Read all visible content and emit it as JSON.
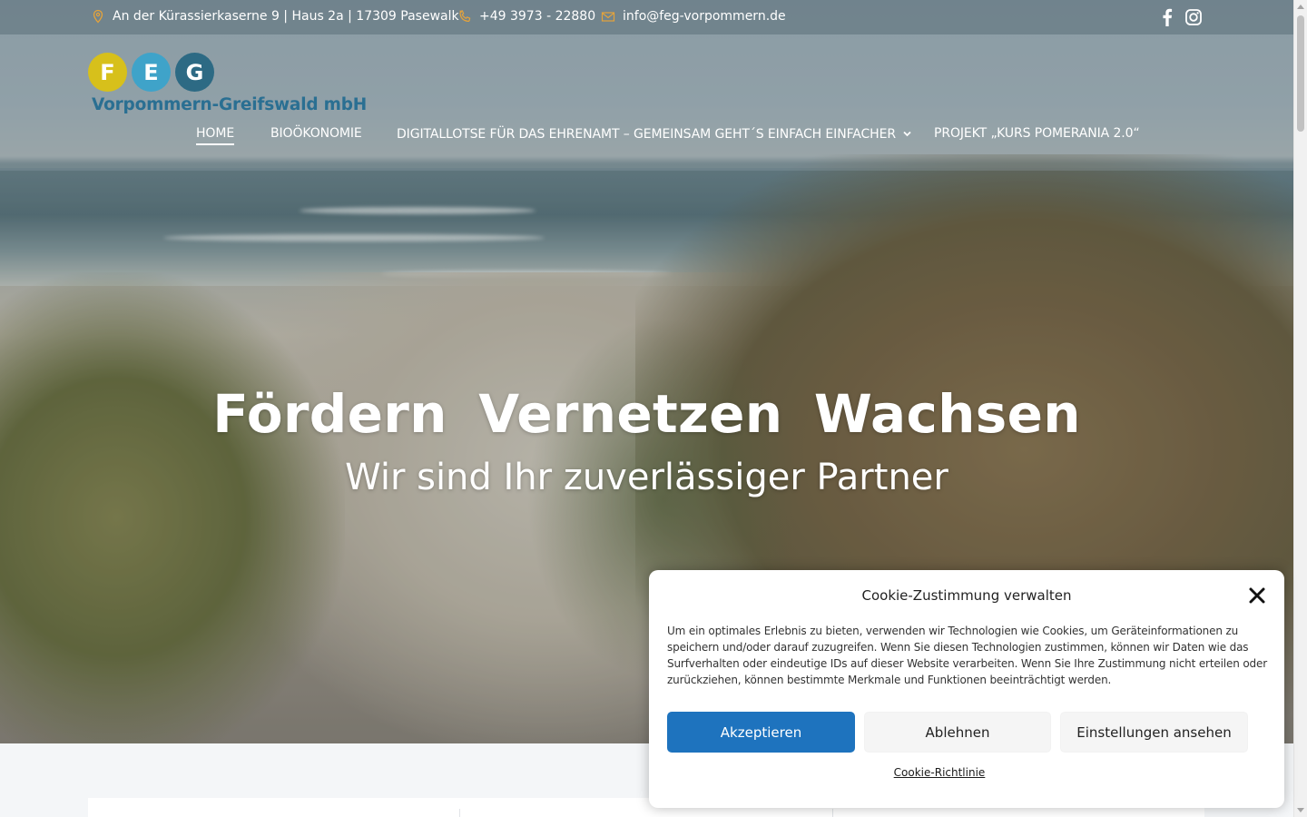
{
  "topbar": {
    "address": "An der Kürassierkaserne 9 | Haus 2a | 17309 Pasewalk",
    "phone": "+49 3973 - 22880",
    "email": "info@feg-vorpommern.de",
    "icons": [
      "location-pin-icon",
      "phone-icon",
      "mail-icon",
      "facebook-icon",
      "instagram-icon"
    ],
    "accent_color": "#e5a33b"
  },
  "logo": {
    "letters": [
      "F",
      "E",
      "G"
    ],
    "circle_colors": [
      "#d7c01b",
      "#3fa3c9",
      "#2d6a84"
    ],
    "subtitle": "Vorpommern-Greifswald mbH",
    "subtitle_color": "#2a6f92"
  },
  "nav": {
    "items": [
      {
        "label": "HOME",
        "active": true
      },
      {
        "label": "BIOÖKONOMIE",
        "active": false
      },
      {
        "label": "DIGITALLOTSE FÜR DAS EHRENAMT – GEMEINSAM GEHT´S EINFACH EINFACHER",
        "active": false,
        "has_dropdown": true
      },
      {
        "label": "PROJEKT „KURS POMERANIA 2.0“",
        "active": false
      }
    ]
  },
  "hero": {
    "headline": "Fördern  Vernetzen  Wachsen",
    "subheadline": "Wir sind Ihr zuverlässiger Partner"
  },
  "cookie": {
    "title": "Cookie-Zustimmung verwalten",
    "text": "Um ein optimales Erlebnis zu bieten, verwenden wir Technologien wie Cookies, um Geräteinformationen zu speichern und/oder darauf zuzugreifen. Wenn Sie diesen Technologien zustimmen, können wir Daten wie das Surfverhalten oder eindeutige IDs auf dieser Website verarbeiten. Wenn Sie Ihre Zustimmung nicht erteilen oder zurückziehen, können bestimmte Merkmale und Funktionen beeinträchtigt werden.",
    "accept_label": "Akzeptieren",
    "deny_label": "Ablehnen",
    "settings_label": "Einstellungen ansehen",
    "policy_link": "Cookie-Richtlinie",
    "accept_color": "#1e73be"
  }
}
